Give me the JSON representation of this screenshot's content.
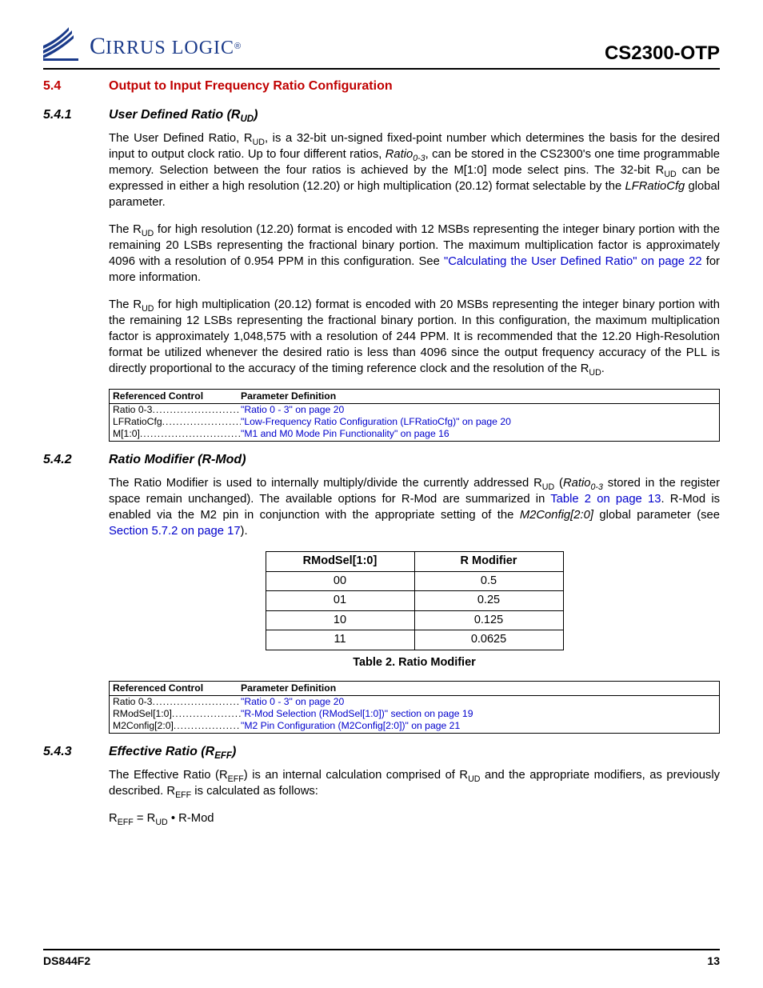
{
  "header": {
    "logo_text": "IRRUS LOGIC",
    "logo_reg": "®",
    "part_no": "CS2300-OTP"
  },
  "sec54": {
    "num": "5.4",
    "title": "Output to Input Frequency Ratio Configuration"
  },
  "sec541": {
    "num": "5.4.1",
    "title_prefix": "User Defined Ratio (R",
    "title_sub": "UD",
    "title_suffix": ")",
    "p1a": "The User Defined Ratio, R",
    "p1a_sub": "UD",
    "p1b": ", is a 32-bit un-signed fixed-point number which determines the basis for the desired input to output clock ratio. Up to four different ratios, ",
    "p1_ital": "Ratio",
    "p1_ital_sub": "0-3",
    "p1c": ", can be stored in the CS2300's one time programmable memory. Selection between the four ratios is achieved by the M[1:0] mode select pins. The 32-bit R",
    "p1c_sub": "UD",
    "p1d": " can be expressed in either a high resolution (12.20) or high multiplication (20.12) format selectable by the ",
    "p1_ital2": "LFRatioCfg",
    "p1e": " global parameter.",
    "p2a": "The R",
    "p2a_sub": "UD",
    "p2b": " for high resolution (12.20) format is encoded with 12 MSBs representing the integer binary portion with the remaining 20 LSBs representing the fractional binary portion. The maximum multiplication factor is approximately 4096 with a resolution of 0.954 PPM in this configuration. See ",
    "p2_link": "\"Calculating the User Defined Ratio\" on page 22",
    "p2c": " for more information.",
    "p3a": "The R",
    "p3a_sub": "UD",
    "p3b": " for high multiplication (20.12) format is encoded with 20 MSBs representing the integer binary portion with the remaining 12 LSBs representing the fractional binary portion. In this configuration, the maximum multiplication factor is approximately 1,048,575 with a resolution of 244 PPM. It is recommended that the 12.20 High-Resolution format be utilized whenever the desired ratio is less than 4096 since the output frequency accuracy of the PLL is directly proportional to the accuracy of the timing reference clock and the resolution of the R",
    "p3b_sub": "UD",
    "p3c": "."
  },
  "refbox1": {
    "h1": "Referenced Control",
    "h2": "Parameter Definition",
    "rows": [
      {
        "c1": "Ratio 0-3",
        "dots": "................................",
        "c2": "\"Ratio 0 - 3\" on page 20"
      },
      {
        "c1": "LFRatioCfg",
        "dots": "...........................",
        "c2": "\"Low-Frequency Ratio Configuration (LFRatioCfg)\" on page 20"
      },
      {
        "c1": "M[1:0]",
        "dots": "....................................",
        "c2": "\"M1 and M0 Mode Pin Functionality\" on page 16"
      }
    ]
  },
  "sec542": {
    "num": "5.4.2",
    "title": "Ratio Modifier (R-Mod)",
    "p1a": "The Ratio Modifier is used to internally multiply/divide the currently addressed R",
    "p1a_sub": "UD",
    "p1b": " (",
    "p1_ital": "Ratio",
    "p1_ital_sub": "0-3",
    "p1c": " stored in the register space remain unchanged). The available options for R-Mod are summarized in ",
    "p1_link1": "Table 2 on page 13",
    "p1d": ". R-Mod is enabled via the M2 pin in conjunction with the appropriate setting of the ",
    "p1_ital2": "M2Config[2:0]",
    "p1e": " global parameter (see ",
    "p1_link2": "Section 5.7.2 on page 17",
    "p1f": ")."
  },
  "chart_data": {
    "type": "table",
    "title": "Table 2. Ratio Modifier",
    "columns": [
      "RModSel[1:0]",
      "R Modifier"
    ],
    "rows": [
      [
        "00",
        "0.5"
      ],
      [
        "01",
        "0.25"
      ],
      [
        "10",
        "0.125"
      ],
      [
        "11",
        "0.0625"
      ]
    ]
  },
  "refbox2": {
    "h1": "Referenced Control",
    "h2": "Parameter Definition",
    "rows": [
      {
        "c1": "Ratio 0-3",
        "dots": "................................",
        "c2": "\"Ratio 0 - 3\" on page 20"
      },
      {
        "c1": "RModSel[1:0]",
        "dots": ".........................",
        "c2": "\"R-Mod Selection (RModSel[1:0])\" section on page 19"
      },
      {
        "c1": "M2Config[2:0]",
        "dots": "........................",
        "c2": "\"M2 Pin Configuration (M2Config[2:0])\" on page 21"
      }
    ]
  },
  "sec543": {
    "num": "5.4.3",
    "title_prefix": "Effective Ratio (R",
    "title_sub": "EFF",
    "title_suffix": ")",
    "p1a": "The Effective Ratio (R",
    "p1a_sub": "EFF",
    "p1b": ") is an internal calculation comprised of R",
    "p1b_sub": "UD",
    "p1c": " and the appropriate modifiers, as previously described. R",
    "p1c_sub": "EFF",
    "p1d": " is calculated as follows:",
    "formula_a": "R",
    "formula_a_sub": "EFF",
    "formula_b": " = R",
    "formula_b_sub": "UD",
    "formula_c": " • R-Mod"
  },
  "footer": {
    "doc": "DS844F2",
    "page": "13"
  }
}
